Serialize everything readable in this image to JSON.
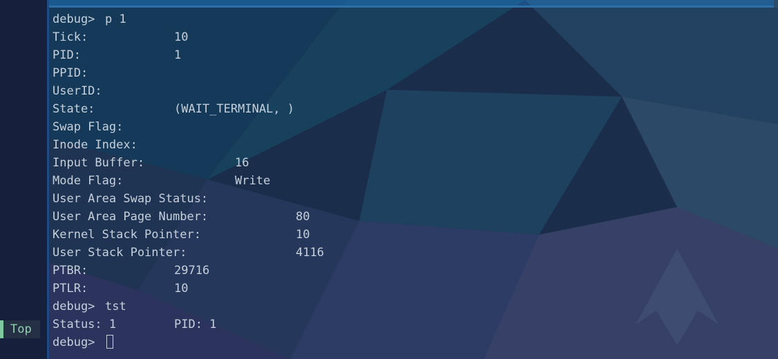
{
  "side_panel": {
    "status_label": "Top"
  },
  "terminal": {
    "lines": [
      {
        "kind": "prompt",
        "prompt": "debug>",
        "command": "p 1"
      },
      {
        "kind": "field",
        "label": "Tick:",
        "value": "10",
        "col": 1
      },
      {
        "kind": "field",
        "label": "PID:",
        "value": "1",
        "col": 1
      },
      {
        "kind": "field",
        "label": "PPID:",
        "value": "",
        "col": 1
      },
      {
        "kind": "field",
        "label": "UserID:",
        "value": "",
        "col": 1
      },
      {
        "kind": "field",
        "label": "State:",
        "value": "(WAIT_TERMINAL, )",
        "col": 1
      },
      {
        "kind": "field",
        "label": "Swap Flag:",
        "value": "",
        "col": 1
      },
      {
        "kind": "field",
        "label": "Inode Index:",
        "value": "",
        "col": 1
      },
      {
        "kind": "field",
        "label": "Input Buffer:",
        "value": "16",
        "col": 2
      },
      {
        "kind": "field",
        "label": "Mode Flag:",
        "value": "Write",
        "col": 2
      },
      {
        "kind": "field",
        "label": "User Area Swap Status:",
        "value": "",
        "col": 3
      },
      {
        "kind": "field",
        "label": "User Area Page Number:",
        "value": "80",
        "col": 3
      },
      {
        "kind": "field",
        "label": "Kernel Stack Pointer:",
        "value": "10",
        "col": 3
      },
      {
        "kind": "field",
        "label": "User Stack Pointer:",
        "value": "4116",
        "col": 3
      },
      {
        "kind": "field",
        "label": "PTBR:",
        "value": "29716",
        "col": 1
      },
      {
        "kind": "field",
        "label": "PTLR:",
        "value": "10",
        "col": 1
      },
      {
        "kind": "prompt",
        "prompt": "debug>",
        "command": "tst"
      },
      {
        "kind": "field",
        "label": "Status: 1",
        "value": "PID: 1",
        "col": 1
      },
      {
        "kind": "input",
        "prompt": "debug>",
        "command": ""
      }
    ]
  },
  "colors": {
    "text": "#c5d0dc",
    "status_accent": "#7fc8a0",
    "terminal_border": "#2d6fa8"
  }
}
